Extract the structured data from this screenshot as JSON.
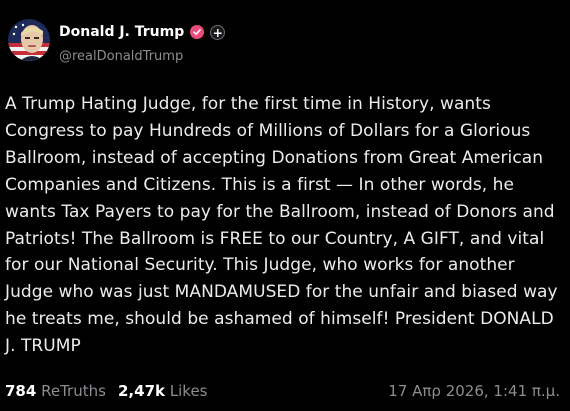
{
  "profile": {
    "display_name": "Donald J. Trump",
    "handle": "@realDonaldTrump",
    "avatar_icon": "flag-portrait-avatar",
    "verified_icon": "verified-badge-icon",
    "verified_color": "#ea4b7b",
    "follow_label": "+"
  },
  "post": {
    "text": "A Trump Hating Judge, for the first time in History, wants Congress to pay Hundreds of Millions of Dollars for a Glorious Ballroom, instead of accepting Donations from Great American Companies and Citizens. This is a first — In other words, he wants Tax Payers to pay for the Ballroom, instead of Donors and Patriots! The Ballroom is FREE to our Country, A GIFT, and vital for our National Security. This Judge, who works for another Judge who was just MANDAMUSED for the unfair and biased way he treats me, should be ashamed of himself! President DONALD J. TRUMP"
  },
  "footer": {
    "retruths_count": "784",
    "retruths_label": "ReTruths",
    "likes_count": "2,47k",
    "likes_label": "Likes",
    "timestamp": "17 Απρ 2026, 1:41 π.μ."
  }
}
